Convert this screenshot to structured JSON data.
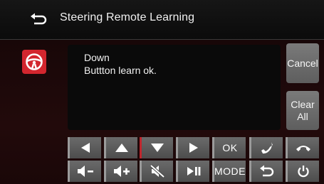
{
  "header": {
    "title": "Steering Remote Learning",
    "back_icon": "return-arrow-icon"
  },
  "status_icon": "steering-wheel-icon",
  "message": {
    "line1": "Down",
    "line2": "Buttton learn ok."
  },
  "side_buttons": {
    "cancel_label": "Cancel",
    "clear_label": "Clear All"
  },
  "keys": {
    "row1": [
      {
        "icon": "previous-arrow-icon"
      },
      {
        "icon": "up-arrow-icon"
      },
      {
        "icon": "down-arrow-icon",
        "selected": true
      },
      {
        "icon": "next-arrow-icon"
      },
      {
        "label": "OK"
      },
      {
        "icon": "phone-answer-icon"
      },
      {
        "icon": "phone-hangup-icon"
      }
    ],
    "row2": [
      {
        "icon": "volume-down-icon"
      },
      {
        "icon": "volume-up-icon"
      },
      {
        "icon": "mute-icon"
      },
      {
        "icon": "play-pause-icon"
      },
      {
        "label": "MODE"
      },
      {
        "icon": "back-icon"
      },
      {
        "icon": "power-icon"
      }
    ]
  },
  "colors": {
    "accent_red": "#d3262e",
    "key_gray": "#5b5b5b",
    "background": "#1c0809"
  }
}
